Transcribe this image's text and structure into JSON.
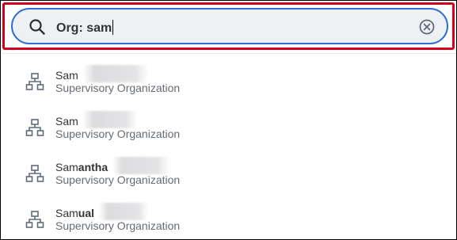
{
  "search": {
    "prefix": "Org: ",
    "query": "sam"
  },
  "results": [
    {
      "match": "Sam",
      "rest": "",
      "type": "Supervisory Organization",
      "icon": "org-chart-icon"
    },
    {
      "match": "Sam",
      "rest": "",
      "type": "Supervisory Organization",
      "icon": "org-chart-icon"
    },
    {
      "match": "Sam",
      "rest": "antha",
      "type": "Supervisory Organization",
      "icon": "org-chart-icon"
    },
    {
      "match": "Sam",
      "rest": "ual",
      "type": "Supervisory Organization",
      "icon": "org-chart-icon"
    }
  ],
  "colors": {
    "highlight_border": "#d0021b",
    "search_border": "#2f6fd4",
    "search_background": "#eef1f4",
    "icon": "#5f6b7a",
    "secondary_text": "#666c73"
  },
  "icons": {
    "search": "search-icon",
    "clear": "clear-icon",
    "result": "org-chart-icon"
  }
}
